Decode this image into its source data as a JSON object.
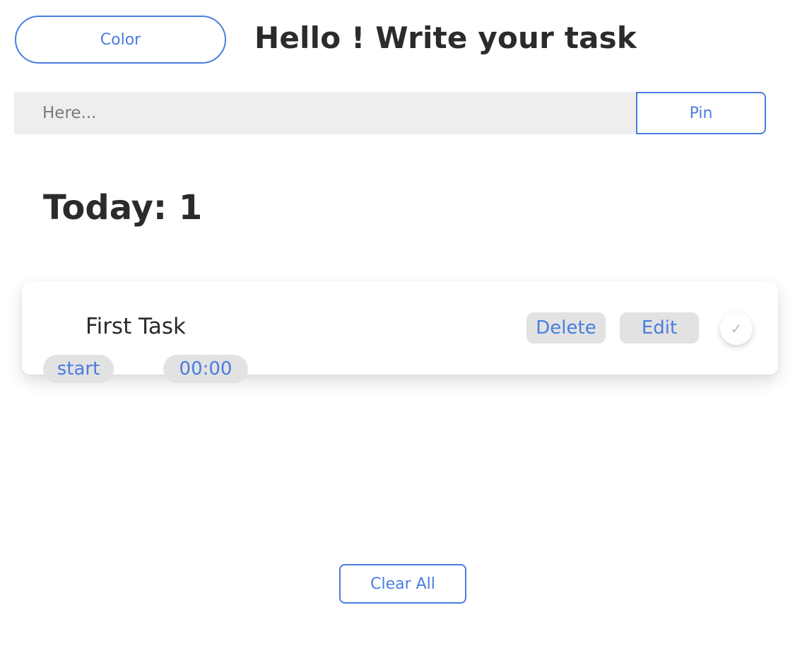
{
  "header": {
    "color_button_label": "Color",
    "title": "Hello ! Write your task"
  },
  "input": {
    "placeholder": "Here...",
    "value": "",
    "pin_button_label": "Pin"
  },
  "today": {
    "heading": "Today: 1"
  },
  "tasks": [
    {
      "name": "First Task",
      "delete_label": "Delete",
      "edit_label": "Edit",
      "complete_icon": "check-icon",
      "complete_glyph": "✓",
      "start_label": "start",
      "timer": "00:00"
    }
  ],
  "footer": {
    "clear_all_label": "Clear All"
  },
  "colors": {
    "accent": "#4a7de0",
    "pill_background": "#e2e2e2",
    "input_background": "#eeeeee",
    "text": "#2b2b2b"
  }
}
